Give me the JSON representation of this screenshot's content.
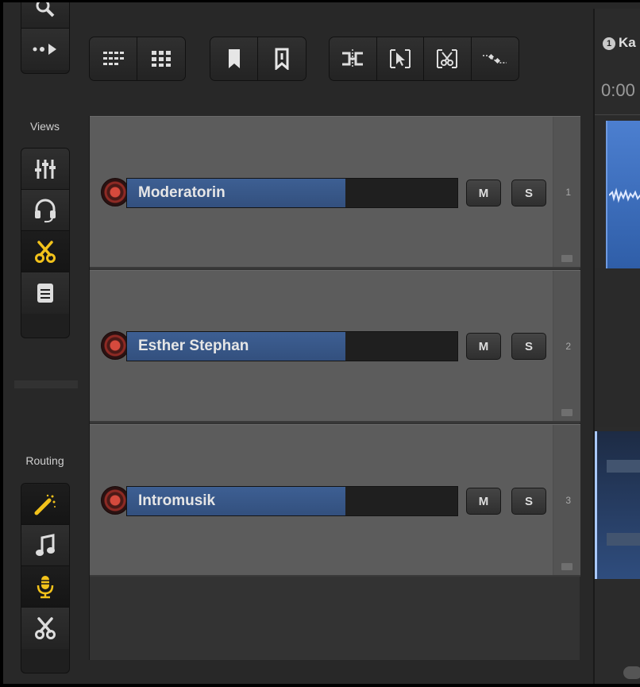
{
  "sidebar": {
    "views_label": "Views",
    "routing_label": "Routing",
    "views": [
      {
        "icon": "mixer-faders-icon",
        "active": false
      },
      {
        "icon": "headphones-icon",
        "active": false
      },
      {
        "icon": "scissors-icon",
        "active": true,
        "color": "#f2c21b"
      },
      {
        "icon": "notes-icon",
        "active": false
      }
    ],
    "routing": [
      {
        "icon": "magic-wand-icon",
        "active": true,
        "color": "#f2c21b"
      },
      {
        "icon": "music-note-icon",
        "active": false
      },
      {
        "icon": "microphone-icon",
        "active": true,
        "color": "#f2c21b"
      },
      {
        "icon": "scissors-icon",
        "active": false
      }
    ]
  },
  "tracks": [
    {
      "name": "Moderatorin",
      "number": "1",
      "mute_label": "M",
      "solo_label": "S"
    },
    {
      "name": "Esther Stephan",
      "number": "2",
      "mute_label": "M",
      "solo_label": "S"
    },
    {
      "name": "Intromusik",
      "number": "3",
      "mute_label": "M",
      "solo_label": "S"
    }
  ],
  "timeline": {
    "marker_number": "1",
    "marker_name": "Ka",
    "time_label": "0:00"
  },
  "colors": {
    "accent": "#f2c21b",
    "track_name_fill": "#3d5f93",
    "clip_blue": "#3a6fc4"
  }
}
